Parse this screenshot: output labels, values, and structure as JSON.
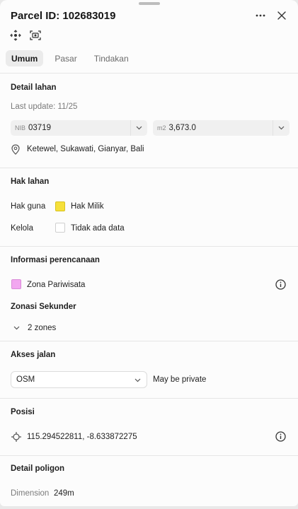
{
  "header": {
    "title": "Parcel ID: 102683019"
  },
  "icons": {
    "more": "more-dots-icon",
    "close": "close-icon",
    "locate": "locate-icon",
    "screenshot": "scan-image-icon"
  },
  "tabs": [
    {
      "label": "Umum",
      "active": true
    },
    {
      "label": "Pasar",
      "active": false
    },
    {
      "label": "Tindakan",
      "active": false
    }
  ],
  "detail_lahan": {
    "title": "Detail lahan",
    "last_update": "Last update: 11/25",
    "nib_prefix": "NIB",
    "nib_value": "03719",
    "area_prefix": "m2",
    "area_value": "3,673.0",
    "location": "Ketewel, Sukawati, Gianyar, Bali"
  },
  "hak_lahan": {
    "title": "Hak lahan",
    "rows": [
      {
        "label": "Hak guna",
        "value": "Hak Milik",
        "swatch": "#f6e03a"
      },
      {
        "label": "Kelola",
        "value": "Tidak ada data",
        "swatch": "#ffffff"
      }
    ]
  },
  "perencanaan": {
    "title": "Informasi perencanaan",
    "zone": "Zona Pariwisata",
    "zone_color": "#f2a7f0",
    "secondary_title": "Zonasi Sekunder",
    "secondary_value": "2 zones"
  },
  "akses_jalan": {
    "title": "Akses jalan",
    "source": "OSM",
    "note": "May be private"
  },
  "posisi": {
    "title": "Posisi",
    "coords": "115.294522811, -8.633872275"
  },
  "poligon": {
    "title": "Detail poligon",
    "dimension_label": "Dimension",
    "dimension_value": "249m"
  }
}
